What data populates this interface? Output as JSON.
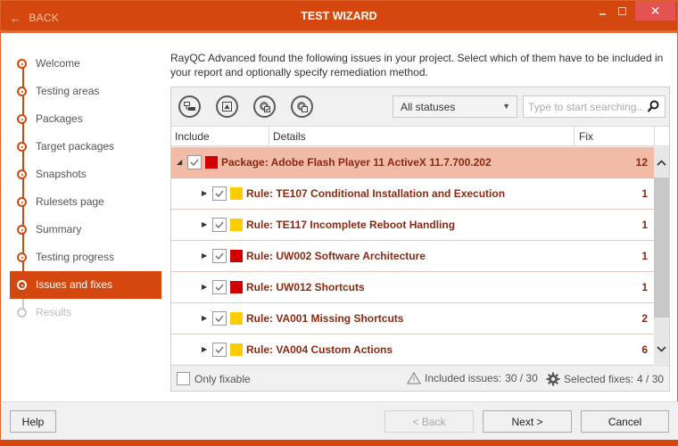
{
  "titlebar": {
    "back_label": "BACK",
    "title": "TEST WIZARD",
    "controls": [
      "minimize",
      "maximize",
      "close"
    ]
  },
  "sidebar": {
    "steps": [
      {
        "label": "Welcome",
        "state": "done"
      },
      {
        "label": "Testing areas",
        "state": "done"
      },
      {
        "label": "Packages",
        "state": "done"
      },
      {
        "label": "Target packages",
        "state": "done"
      },
      {
        "label": "Snapshots",
        "state": "done"
      },
      {
        "label": "Rulesets page",
        "state": "done"
      },
      {
        "label": "Summary",
        "state": "done"
      },
      {
        "label": "Testing progress",
        "state": "done"
      },
      {
        "label": "Issues and fixes",
        "state": "active"
      },
      {
        "label": "Results",
        "state": "disabled"
      }
    ]
  },
  "main": {
    "intro": "RayQC Advanced found the following issues in your project. Select which of them have to be included in your report and optionally specify remediation method.",
    "toolbar": {
      "icons": [
        "collapse-tree-icon",
        "expand-icon",
        "select-fixes-icon",
        "deselect-fixes-icon"
      ],
      "status_filter": "All statuses",
      "search_placeholder": "Type to start searching..."
    },
    "columns": {
      "include": "Include",
      "details": "Details",
      "fix": "Fix"
    },
    "rows": [
      {
        "level": "package",
        "expanded": true,
        "checked": true,
        "severity": "error",
        "text": "Package: Adobe Flash Player 11 ActiveX 11.7.700.202",
        "count": "12"
      },
      {
        "level": "rule",
        "expanded": false,
        "checked": true,
        "severity": "warning",
        "text": "Rule: TE107 Conditional Installation and Execution",
        "count": "1"
      },
      {
        "level": "rule",
        "expanded": false,
        "checked": true,
        "severity": "warning",
        "text": "Rule: TE117 Incomplete Reboot Handling",
        "count": "1"
      },
      {
        "level": "rule",
        "expanded": false,
        "checked": true,
        "severity": "error",
        "text": "Rule: UW002 Software Architecture",
        "count": "1"
      },
      {
        "level": "rule",
        "expanded": false,
        "checked": true,
        "severity": "error",
        "text": "Rule: UW012 Shortcuts",
        "count": "1"
      },
      {
        "level": "rule",
        "expanded": false,
        "checked": true,
        "severity": "warning",
        "text": "Rule: VA001 Missing Shortcuts",
        "count": "2"
      },
      {
        "level": "rule",
        "expanded": false,
        "checked": true,
        "severity": "warning",
        "text": "Rule: VA004 Custom Actions",
        "count": "6"
      }
    ],
    "severity_colors": {
      "error": "#d10000",
      "warning": "#ffcc00"
    },
    "footer": {
      "only_fixable_label": "Only fixable",
      "only_fixable_checked": false,
      "included_issues_label": "Included issues:",
      "included_issues_value": "30 / 30",
      "selected_fixes_label": "Selected fixes:",
      "selected_fixes_value": "4 / 30"
    }
  },
  "buttons": {
    "help": "Help",
    "back": "< Back",
    "next": "Next >",
    "cancel": "Cancel"
  },
  "colors": {
    "accent": "#d4480f",
    "package_row": "#f1bba8",
    "item_text": "#8a2a12"
  }
}
